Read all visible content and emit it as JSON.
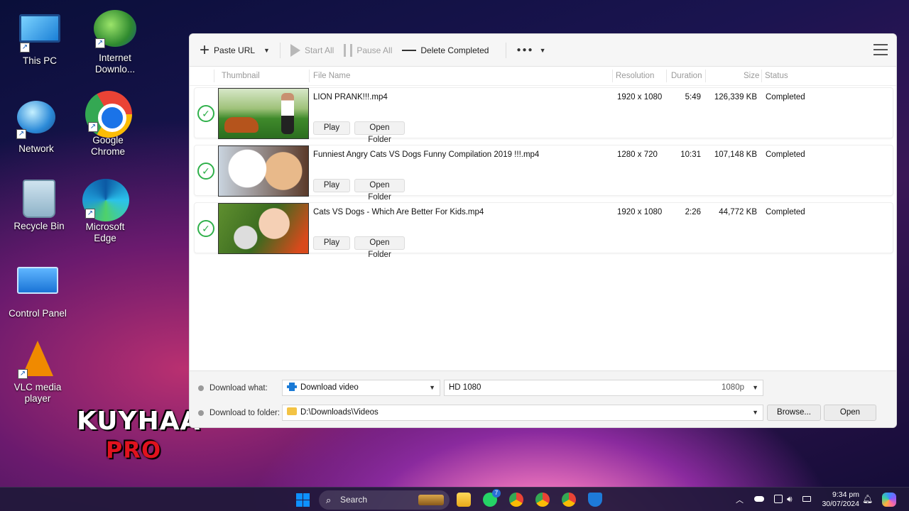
{
  "desktop": {
    "icons": [
      {
        "label": "This PC"
      },
      {
        "label": "Internet Downlo..."
      },
      {
        "label": "Network"
      },
      {
        "label": "Google Chrome"
      },
      {
        "label": "Recycle Bin"
      },
      {
        "label": "Microsoft Edge"
      },
      {
        "label": "Control Panel"
      },
      {
        "label": "VLC media player"
      }
    ],
    "watermark": {
      "line1": "KUYHAA",
      "line2": "PRO"
    }
  },
  "toolbar": {
    "paste_url": "Paste URL",
    "start_all": "Start All",
    "pause_all": "Pause All",
    "delete_completed": "Delete Completed",
    "more": "●●●"
  },
  "columns": {
    "thumbnail": "Thumbnail",
    "file_name": "File Name",
    "resolution": "Resolution",
    "duration": "Duration",
    "size": "Size",
    "status": "Status"
  },
  "downloads": [
    {
      "file_name": "LION PRANK!!!.mp4",
      "resolution": "1920 x 1080",
      "duration": "5:49",
      "size": "126,339 KB",
      "status": "Completed",
      "play": "Play",
      "open_folder": "Open Folder"
    },
    {
      "file_name": "Funniest Angry Cats VS Dogs Funny Compilation 2019 !!!.mp4",
      "resolution": "1280 x 720",
      "duration": "10:31",
      "size": "107,148 KB",
      "status": "Completed",
      "play": "Play",
      "open_folder": "Open Folder"
    },
    {
      "file_name": "Cats VS Dogs - Which Are Better For Kids.mp4",
      "resolution": "1920 x 1080",
      "duration": "2:26",
      "size": "44,772 KB",
      "status": "Completed",
      "play": "Play",
      "open_folder": "Open Folder"
    }
  ],
  "bottom": {
    "download_what_label": "Download what:",
    "download_what_value": "Download video",
    "quality_value": "HD 1080",
    "quality_tag": "1080p",
    "download_to_label": "Download to folder:",
    "folder_value": "D:\\Downloads\\Videos",
    "browse": "Browse...",
    "open": "Open"
  },
  "taskbar": {
    "search_placeholder": "Search",
    "whatsapp_badge": "7",
    "time": "9:34 pm",
    "date": "30/07/2024"
  }
}
